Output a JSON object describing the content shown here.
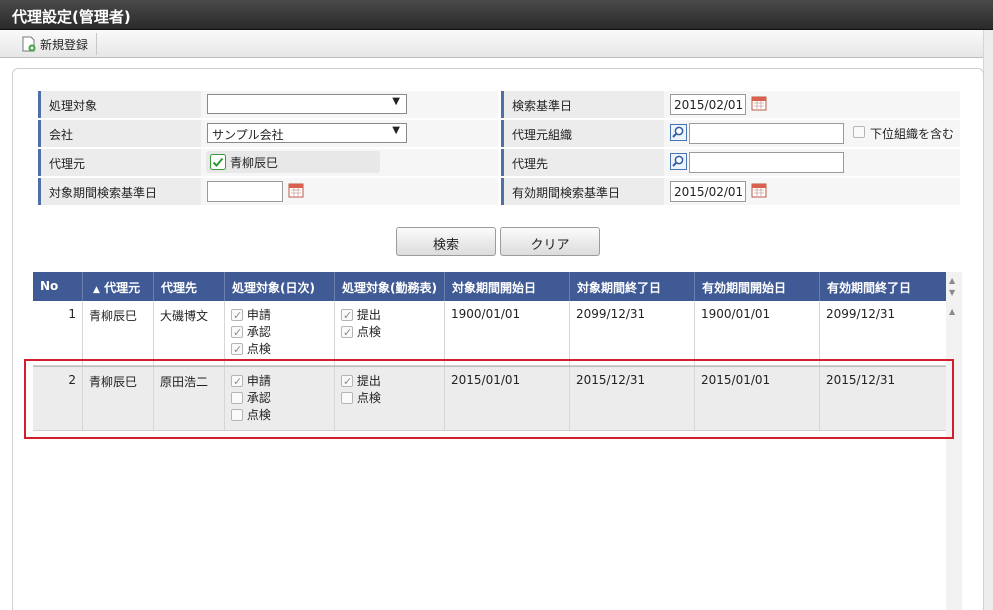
{
  "window": {
    "title": "代理設定(管理者)"
  },
  "toolbar": {
    "new_label": "新規登録"
  },
  "form": {
    "target_label": "処理対象",
    "target_value": "",
    "company_label": "会社",
    "company_value": "サンプル会社",
    "delegator_label": "代理元",
    "delegator_value": "青柳辰巳",
    "period_base_label": "対象期間検索基準日",
    "period_base_value": "",
    "search_base_label": "検索基準日",
    "search_base_value": "2015/02/01",
    "delegator_org_label": "代理元組織",
    "delegator_org_value": "",
    "include_sub_label": "下位組織を含む",
    "delegate_label": "代理先",
    "delegate_value": "",
    "valid_base_label": "有効期間検索基準日",
    "valid_base_value": "2015/02/01"
  },
  "buttons": {
    "search": "検索",
    "clear": "クリア"
  },
  "grid": {
    "headers": {
      "no": "No",
      "sort_mark": "▲",
      "delegator": "代理元",
      "delegate": "代理先",
      "target_daily": "処理対象(日次)",
      "target_attendance": "処理対象(勤務表)",
      "target_start": "対象期間開始日",
      "target_end": "対象期間終了日",
      "valid_start": "有効期間開始日",
      "valid_end": "有効期間終了日"
    },
    "rows": [
      {
        "no": "1",
        "delegator": "青柳辰巳",
        "delegate": "大磯博文",
        "daily": [
          {
            "label": "申請",
            "checked": true
          },
          {
            "label": "承認",
            "checked": true
          },
          {
            "label": "点検",
            "checked": true
          }
        ],
        "attendance": [
          {
            "label": "提出",
            "checked": true
          },
          {
            "label": "点検",
            "checked": true
          }
        ],
        "target_start": "1900/01/01",
        "target_end": "2099/12/31",
        "valid_start": "1900/01/01",
        "valid_end": "2099/12/31"
      },
      {
        "no": "2",
        "delegator": "青柳辰巳",
        "delegate": "原田浩二",
        "daily": [
          {
            "label": "申請",
            "checked": true
          },
          {
            "label": "承認",
            "checked": false
          },
          {
            "label": "点検",
            "checked": false
          }
        ],
        "attendance": [
          {
            "label": "提出",
            "checked": true
          },
          {
            "label": "点検",
            "checked": false
          }
        ],
        "target_start": "2015/01/01",
        "target_end": "2015/12/31",
        "valid_start": "2015/01/01",
        "valid_end": "2015/12/31"
      }
    ]
  },
  "colors": {
    "header_bg": "#3f5a94",
    "highlight": "#d21f2b",
    "titlebar": "#333333"
  }
}
